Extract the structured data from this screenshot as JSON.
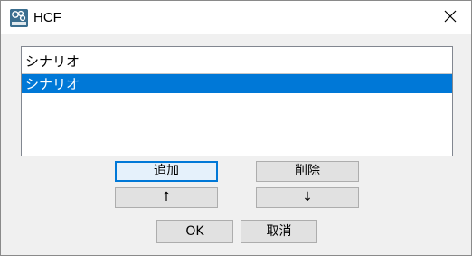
{
  "window": {
    "title": "HCF"
  },
  "icons": {
    "app": "hcf-app-icon",
    "close": "close-icon"
  },
  "list": {
    "items": [
      {
        "label": "シナリオ",
        "selected": false
      },
      {
        "label": "シナリオ",
        "selected": true
      }
    ]
  },
  "buttons": {
    "add": "追加",
    "delete": "削除",
    "move_up": "↑",
    "move_down": "↓",
    "ok": "OK",
    "cancel": "取消"
  },
  "colors": {
    "selection": "#0078d7",
    "button_face": "#e1e1e1",
    "dialog_bg": "#f0f0f0"
  }
}
